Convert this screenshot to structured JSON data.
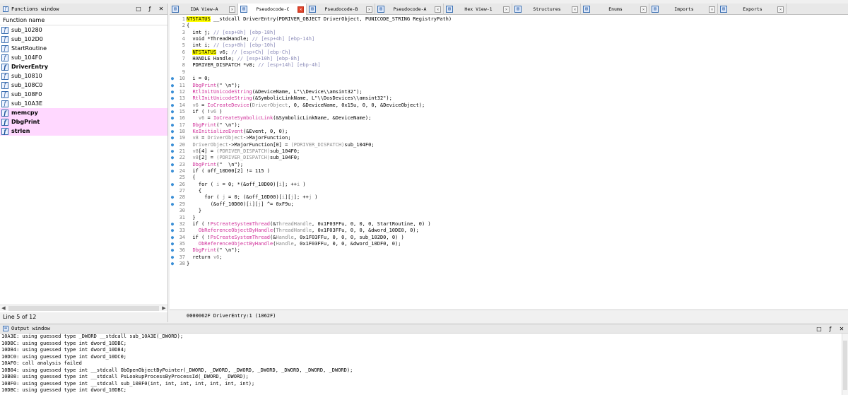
{
  "functions_window": {
    "title": "Functions window",
    "column_header": "Function name",
    "controls": [
      "□",
      "ƒ",
      "✕"
    ],
    "items": [
      {
        "name": "sub_10280",
        "style": ""
      },
      {
        "name": "sub_102D0",
        "style": ""
      },
      {
        "name": "StartRoutine",
        "style": ""
      },
      {
        "name": "sub_104F0",
        "style": ""
      },
      {
        "name": "DriverEntry",
        "style": "bold"
      },
      {
        "name": "sub_10810",
        "style": ""
      },
      {
        "name": "sub_108C0",
        "style": ""
      },
      {
        "name": "sub_108F0",
        "style": ""
      },
      {
        "name": "sub_10A3E",
        "style": ""
      },
      {
        "name": "memcpy",
        "style": "lib bold"
      },
      {
        "name": "DbgPrint",
        "style": "lib bold"
      },
      {
        "name": "strlen",
        "style": "lib bold"
      }
    ],
    "status": "Line 5 of 12"
  },
  "tabs": [
    {
      "label": "IDA View-A",
      "active": false,
      "icon": "ida-view-icon"
    },
    {
      "label": "Pseudocode-C",
      "active": true,
      "icon": "pseudocode-icon"
    },
    {
      "label": "Pseudocode-B",
      "active": false,
      "icon": "pseudocode-icon"
    },
    {
      "label": "Pseudocode-A",
      "active": false,
      "icon": "pseudocode-icon"
    },
    {
      "label": "Hex View-1",
      "active": false,
      "icon": "hex-view-icon"
    },
    {
      "label": "Structures",
      "active": false,
      "icon": "structures-icon"
    },
    {
      "label": "Enums",
      "active": false,
      "icon": "enums-icon"
    },
    {
      "label": "Imports",
      "active": false,
      "icon": "imports-icon"
    },
    {
      "label": "Exports",
      "active": false,
      "icon": "exports-icon"
    }
  ],
  "code_lines": [
    {
      "n": "1",
      "bp": false,
      "html": "<span class=\"hl\">NTSTATUS</span> __stdcall DriverEntry(PDRIVER_OBJECT DriverObject, PUNICODE_STRING RegistryPath)"
    },
    {
      "n": "2",
      "bp": false,
      "html": "{"
    },
    {
      "n": "3",
      "bp": false,
      "html": "  int j; <span class=\"c-cm\">// [esp+0h] [ebp-18h]</span>"
    },
    {
      "n": "4",
      "bp": false,
      "html": "  void *ThreadHandle; <span class=\"c-cm\">// [esp+4h] [ebp-14h]</span>"
    },
    {
      "n": "5",
      "bp": false,
      "html": "  int i; <span class=\"c-cm\">// [esp+8h] [ebp-10h]</span>"
    },
    {
      "n": "6",
      "bp": false,
      "html": "  <span class=\"hl\">NTSTATUS</span> v6; <span class=\"c-cm\">// [esp+Ch] [ebp-Ch]</span>"
    },
    {
      "n": "7",
      "bp": false,
      "html": "  HANDLE Handle; <span class=\"c-cm\">// [esp+10h] [ebp-8h]</span>"
    },
    {
      "n": "8",
      "bp": false,
      "html": "  PDRIVER_DISPATCH *v8; <span class=\"c-cm\">// [esp+14h] [ebp-4h]</span>"
    },
    {
      "n": "9",
      "bp": false,
      "html": ""
    },
    {
      "n": "10",
      "bp": true,
      "html": "  i = 0;"
    },
    {
      "n": "11",
      "bp": true,
      "html": "  <span class=\"c-fn\">DbgPrint</span>(\" \\n\");"
    },
    {
      "n": "12",
      "bp": true,
      "html": "  <span class=\"c-fn\">RtlInitUnicodeString</span>(&amp;DeviceName, L\"\\\\Device\\\\amsint32\");"
    },
    {
      "n": "13",
      "bp": true,
      "html": "  <span class=\"c-fn\">RtlInitUnicodeString</span>(&amp;SymbolicLinkName, L\"\\\\DosDevices\\\\amsint32\");"
    },
    {
      "n": "14",
      "bp": true,
      "html": "  <span class=\"c-gray\">v6</span> = <span class=\"c-fn\">IoCreateDevice</span>(<span class=\"c-gray\">DriverObject</span>, 0, &amp;DeviceName, 0x15u, 0, 0, &amp;DeviceObject);"
    },
    {
      "n": "15",
      "bp": true,
      "html": "  if ( !<span class=\"c-gray\">v6</span> )"
    },
    {
      "n": "16",
      "bp": true,
      "html": "    <span class=\"c-gray\">v6</span> = <span class=\"c-fn\">IoCreateSymbolicLink</span>(&amp;SymbolicLinkName, &amp;DeviceName);"
    },
    {
      "n": "17",
      "bp": true,
      "html": "  <span class=\"c-fn\">DbgPrint</span>(\" \\n\");"
    },
    {
      "n": "18",
      "bp": true,
      "html": "  <span class=\"c-fn\">KeInitializeEvent</span>(&amp;Event, 0, 0);"
    },
    {
      "n": "19",
      "bp": true,
      "html": "  <span class=\"c-gray\">v8</span> = <span class=\"c-gray\">DriverObject</span>-&gt;MajorFunction;"
    },
    {
      "n": "20",
      "bp": true,
      "html": "  <span class=\"c-gray\">DriverObject</span>-&gt;MajorFunction[0] = <span class=\"c-gray\">(PDRIVER_DISPATCH)</span>sub_104F0;"
    },
    {
      "n": "21",
      "bp": true,
      "html": "  <span class=\"c-gray\">v8</span>[4] = <span class=\"c-gray\">(PDRIVER_DISPATCH)</span>sub_104F0;"
    },
    {
      "n": "22",
      "bp": true,
      "html": "  <span class=\"c-gray\">v8</span>[2] = <span class=\"c-gray\">(PDRIVER_DISPATCH)</span>sub_104F0;"
    },
    {
      "n": "23",
      "bp": true,
      "html": "  <span class=\"c-fn\">DbgPrint</span>(\"  \\n\");"
    },
    {
      "n": "24",
      "bp": true,
      "html": "  if ( off_10D00[2] != 115 )"
    },
    {
      "n": "25",
      "bp": false,
      "html": "  {"
    },
    {
      "n": "26",
      "bp": true,
      "html": "    for ( <span class=\"c-gray\">i</span> = 0; *(&amp;off_10D00)[<span class=\"c-gray\">i</span>]; ++<span class=\"c-gray\">i</span> )"
    },
    {
      "n": "27",
      "bp": false,
      "html": "    {"
    },
    {
      "n": "28",
      "bp": true,
      "html": "      for ( <span class=\"c-gray\">j</span> = 0; (&amp;off_10D00)[<span class=\"c-gray\">i</span>][<span class=\"c-gray\">j</span>]; ++<span class=\"c-gray\">j</span> )"
    },
    {
      "n": "29",
      "bp": true,
      "html": "        (&amp;off_10D00)[<span class=\"c-gray\">i</span>][<span class=\"c-gray\">j</span>] ^= 0xF9u;"
    },
    {
      "n": "30",
      "bp": false,
      "html": "    }"
    },
    {
      "n": "31",
      "bp": false,
      "html": "  }"
    },
    {
      "n": "32",
      "bp": true,
      "html": "  if ( !<span class=\"c-fn\">PsCreateSystemThread</span>(&amp;<span class=\"c-gray\">ThreadHandle</span>, 0x1F03FFu, 0, 0, 0, StartRoutine, 0) )"
    },
    {
      "n": "33",
      "bp": true,
      "html": "    <span class=\"c-fn\">ObReferenceObjectByHandle</span>(<span class=\"c-gray\">ThreadHandle</span>, 0x1F03FFu, 0, 0, &amp;dword_10DE0, 0);"
    },
    {
      "n": "34",
      "bp": true,
      "html": "  if ( !<span class=\"c-fn\">PsCreateSystemThread</span>(&amp;<span class=\"c-gray\">Handle</span>, 0x1F03FFu, 0, 0, 0, sub_102D0, 0) )"
    },
    {
      "n": "35",
      "bp": true,
      "html": "    <span class=\"c-fn\">ObReferenceObjectByHandle</span>(<span class=\"c-gray\">Handle</span>, 0x1F03FFu, 0, 0, &amp;dword_10DF0, 0);"
    },
    {
      "n": "36",
      "bp": true,
      "html": "  <span class=\"c-fn\">DbgPrint</span>(\" \\n\");"
    },
    {
      "n": "37",
      "bp": true,
      "html": "  return <span class=\"c-gray\">v6</span>;"
    },
    {
      "n": "38",
      "bp": true,
      "html": "}"
    }
  ],
  "code_status": "0000062F DriverEntry:1 (1062F)",
  "output_window": {
    "title": "Output window",
    "controls": [
      "□",
      "ƒ",
      "✕"
    ],
    "lines": [
      "10A3E: using guessed type _DWORD __stdcall sub_10A3E(_DWORD);",
      "10DBC: using guessed type int dword_10DBC;",
      "10D84: using guessed type int dword_10D84;",
      "10DC0: using guessed type int dword_10DC0;",
      "10AF0: call analysis failed",
      "10B04: using guessed type int __stdcall ObOpenObjectByPointer(_DWORD, _DWORD, _DWORD, _DWORD, _DWORD, _DWORD, _DWORD);",
      "10B08: using guessed type int __stdcall PsLookupProcessByProcessId(_DWORD, _DWORD);",
      "108F0: using guessed type int __stdcall sub_108F0(int, int, int, int, int, int, int);",
      "10DBC: using guessed type int dword_10DBC;"
    ]
  }
}
